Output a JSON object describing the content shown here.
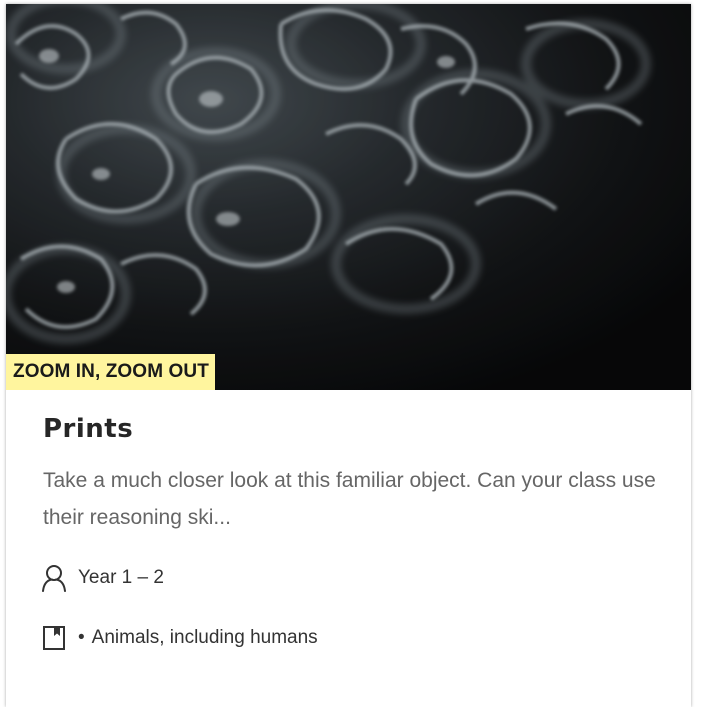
{
  "card": {
    "tag": "ZOOM IN, ZOOM OUT",
    "title": "Prints",
    "description": "Take a much closer look at this familiar object. Can your class use their reasoning ski...",
    "year": "Year 1 – 2",
    "subject_bullet": "•",
    "subject": "Animals, including humans",
    "icons": {
      "image": "fingerprint-closeup-photo",
      "year": "person-icon",
      "subject": "book-icon"
    },
    "colors": {
      "tag_background": "#fff59e",
      "title": "#262626",
      "description": "#666666",
      "meta_text": "#333333"
    }
  }
}
